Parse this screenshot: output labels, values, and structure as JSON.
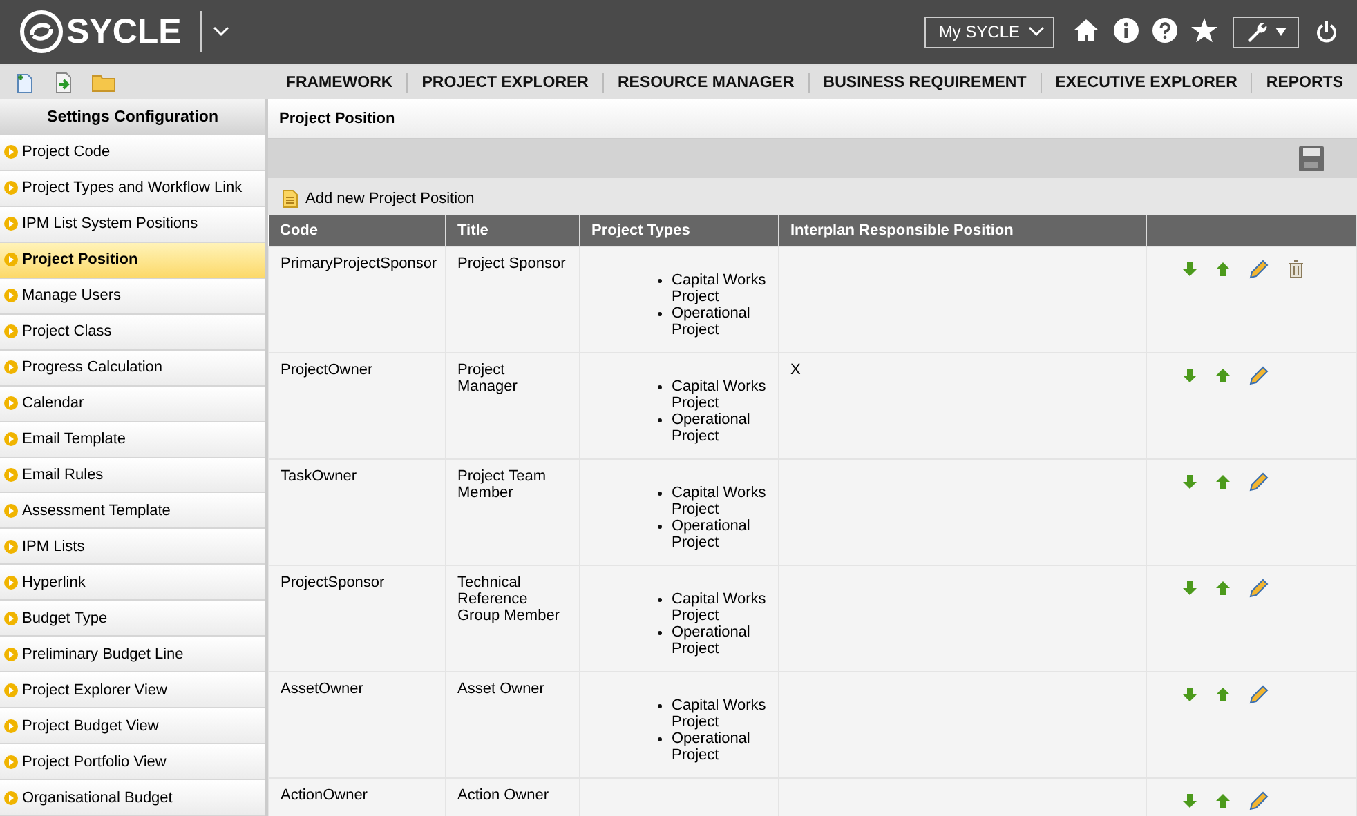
{
  "header": {
    "logo": "SYCLE",
    "my_menu": "My SYCLE"
  },
  "nav": [
    "FRAMEWORK",
    "PROJECT EXPLORER",
    "RESOURCE MANAGER",
    "BUSINESS REQUIREMENT",
    "EXECUTIVE EXPLORER",
    "REPORTS"
  ],
  "sidebar": {
    "title": "Settings Configuration",
    "items": [
      {
        "label": "Project Code",
        "selected": false
      },
      {
        "label": "Project Types and Workflow Link",
        "selected": false
      },
      {
        "label": "IPM List System Positions",
        "selected": false
      },
      {
        "label": "Project Position",
        "selected": true
      },
      {
        "label": "Manage Users",
        "selected": false
      },
      {
        "label": "Project Class",
        "selected": false
      },
      {
        "label": "Progress Calculation",
        "selected": false
      },
      {
        "label": "Calendar",
        "selected": false
      },
      {
        "label": "Email Template",
        "selected": false
      },
      {
        "label": "Email Rules",
        "selected": false
      },
      {
        "label": "Assessment Template",
        "selected": false
      },
      {
        "label": "IPM Lists",
        "selected": false
      },
      {
        "label": "Hyperlink",
        "selected": false
      },
      {
        "label": "Budget Type",
        "selected": false
      },
      {
        "label": "Preliminary Budget Line",
        "selected": false
      },
      {
        "label": "Project Explorer View",
        "selected": false
      },
      {
        "label": "Project Budget View",
        "selected": false
      },
      {
        "label": "Project Portfolio View",
        "selected": false
      },
      {
        "label": "Organisational Budget",
        "selected": false
      }
    ]
  },
  "panel": {
    "title": "Project Position",
    "add_link": "Add new Project Position",
    "table": {
      "columns": [
        "Code",
        "Title",
        "Project Types",
        "Interplan Responsible Position"
      ],
      "rows": [
        {
          "code": "PrimaryProjectSponsor",
          "title": "Project Sponsor",
          "project_types": [
            "Capital Works Project",
            "Operational Project"
          ],
          "responsible": "",
          "actions": [
            {
              "kind": "move-down"
            },
            {
              "kind": "move-up"
            },
            {
              "kind": "edit"
            },
            {
              "kind": "delete"
            }
          ]
        },
        {
          "code": "ProjectOwner",
          "title": "Project Manager",
          "project_types": [
            "Capital Works Project",
            "Operational Project"
          ],
          "responsible": "X",
          "actions": [
            {
              "kind": "move-down"
            },
            {
              "kind": "move-up"
            },
            {
              "kind": "edit"
            }
          ]
        },
        {
          "code": "TaskOwner",
          "title": "Project Team Member",
          "project_types": [
            "Capital Works Project",
            "Operational Project"
          ],
          "responsible": "",
          "actions": [
            {
              "kind": "move-down"
            },
            {
              "kind": "move-up"
            },
            {
              "kind": "edit"
            }
          ]
        },
        {
          "code": "ProjectSponsor",
          "title": "Technical Reference Group Member",
          "project_types": [
            "Capital Works Project",
            "Operational Project"
          ],
          "responsible": "",
          "actions": [
            {
              "kind": "move-down"
            },
            {
              "kind": "move-up"
            },
            {
              "kind": "edit"
            }
          ]
        },
        {
          "code": "AssetOwner",
          "title": "Asset Owner",
          "project_types": [
            "Capital Works Project",
            "Operational Project"
          ],
          "responsible": "",
          "actions": [
            {
              "kind": "move-down"
            },
            {
              "kind": "move-up"
            },
            {
              "kind": "edit"
            }
          ]
        },
        {
          "code": "ActionOwner",
          "title": "Action Owner",
          "responsible": "",
          "actions": [
            {
              "kind": "move-down"
            },
            {
              "kind": "move-up"
            },
            {
              "kind": "edit"
            }
          ]
        }
      ]
    }
  }
}
